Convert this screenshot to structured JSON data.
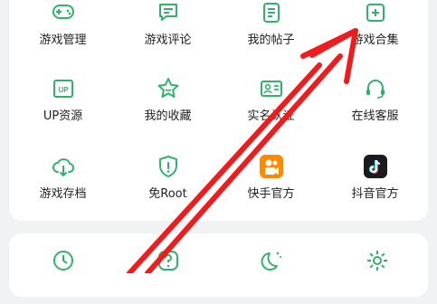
{
  "grid": {
    "row1": [
      "游戏管理",
      "游戏评论",
      "我的帖子",
      "游戏合集"
    ],
    "row2": [
      "UP资源",
      "我的收藏",
      "实名认证",
      "在线客服"
    ],
    "row3": [
      "游戏存档",
      "免Root",
      "快手官方",
      "抖音官方"
    ]
  },
  "colors": {
    "icon_green": "#2fb36a",
    "arrow_red": "#ee1c1c",
    "kuaishou_orange": "#ff8a00",
    "douyin_dark": "#1b1b1f"
  }
}
